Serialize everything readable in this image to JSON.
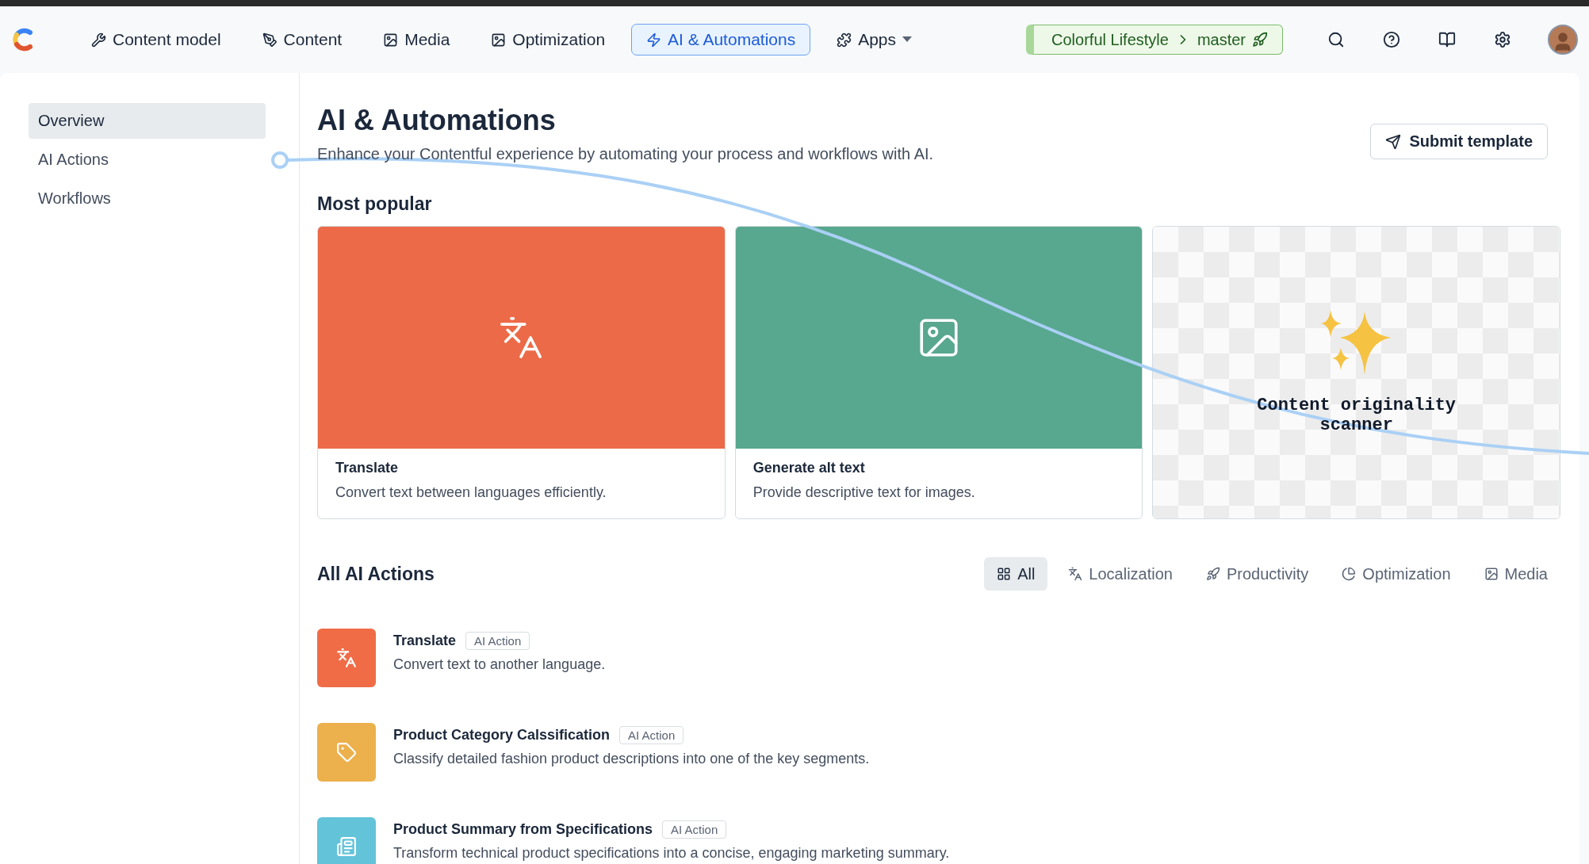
{
  "nav": {
    "items": [
      {
        "label": "Content model",
        "selected": false,
        "dropdown": false
      },
      {
        "label": "Content",
        "selected": false,
        "dropdown": false
      },
      {
        "label": "Media",
        "selected": false,
        "dropdown": false
      },
      {
        "label": "Optimization",
        "selected": false,
        "dropdown": false
      },
      {
        "label": "AI & Automations",
        "selected": true,
        "dropdown": false
      },
      {
        "label": "Apps",
        "selected": false,
        "dropdown": true
      }
    ],
    "space": {
      "name": "Colorful Lifestyle",
      "environment": "master"
    }
  },
  "sidebar": {
    "items": [
      {
        "label": "Overview",
        "selected": true
      },
      {
        "label": "AI Actions",
        "selected": false
      },
      {
        "label": "Workflows",
        "selected": false
      }
    ]
  },
  "header": {
    "title": "AI & Automations",
    "description": "Enhance your Contentful experience by automating your process and workflows with AI.",
    "button": "Submit template"
  },
  "popular": {
    "heading": "Most popular",
    "cards": [
      {
        "kind": "icon",
        "color": "#ec6a47",
        "title": "Translate",
        "description": "Convert text between languages efficiently."
      },
      {
        "kind": "icon",
        "color": "#58a78f",
        "title": "Generate alt text",
        "description": "Provide descriptive text for images."
      },
      {
        "kind": "checker",
        "caption": "Content originality scanner"
      }
    ]
  },
  "actions": {
    "heading": "All AI Actions",
    "filters": [
      {
        "label": "All",
        "selected": true
      },
      {
        "label": "Localization",
        "selected": false
      },
      {
        "label": "Productivity",
        "selected": false
      },
      {
        "label": "Optimization",
        "selected": false
      },
      {
        "label": "Media",
        "selected": false
      }
    ],
    "rows": [
      {
        "title": "Translate",
        "badge": "AI Action",
        "description": "Convert text to another language.",
        "color": "#ef6c47"
      },
      {
        "title": "Product Category Calssification",
        "badge": "AI Action",
        "description": "Classify detailed fashion product descriptions into one of the key segments.",
        "color": "#ecb04d"
      },
      {
        "title": "Product Summary from Specifications",
        "badge": "AI Action",
        "description": "Transform technical product specifications into a concise, engaging marketing summary.",
        "color": "#63c3d9"
      }
    ]
  }
}
